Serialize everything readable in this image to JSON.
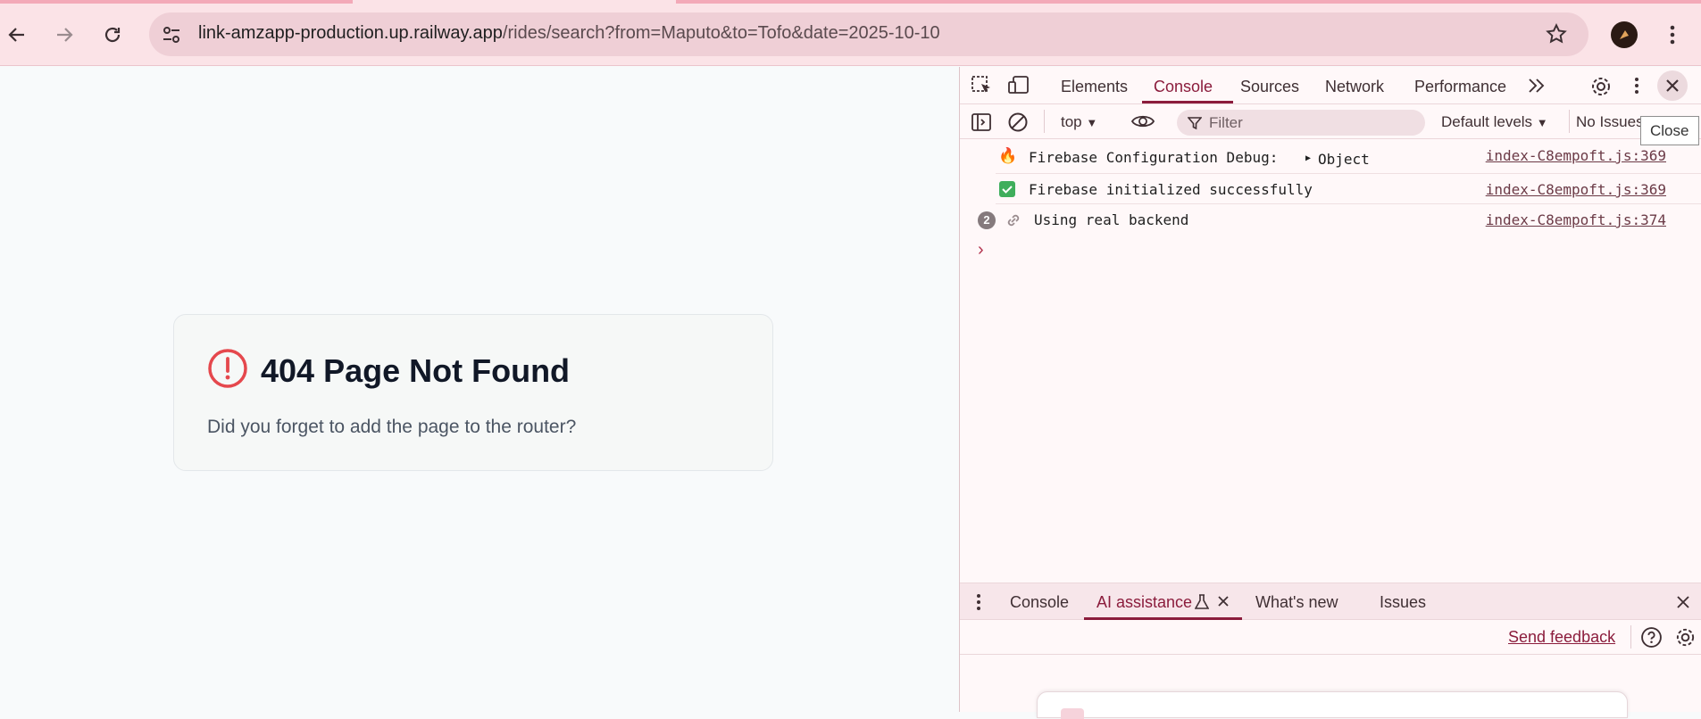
{
  "browser": {
    "url_host": "link-amzapp-production.up.railway.app",
    "url_path": "/rides/search?from=Maputo&to=Tofo&date=2025-10-10"
  },
  "page": {
    "title": "404 Page Not Found",
    "message": "Did you forget to add the page to the router?"
  },
  "devtools": {
    "tabs": [
      "Elements",
      "Console",
      "Sources",
      "Network",
      "Performance"
    ],
    "active_tab": "Console",
    "toolbar": {
      "context": "top",
      "filter_placeholder": "Filter",
      "levels": "Default levels",
      "issues": "No Issues"
    },
    "messages": [
      {
        "icon": "fire-icon",
        "text": "Firebase Configuration Debug:",
        "object": "Object",
        "source": "index-C8empoft.js:369"
      },
      {
        "icon": "check-icon",
        "text": "Firebase initialized successfully",
        "source": "index-C8empoft.js:369"
      },
      {
        "icon": "link-icon",
        "count": "2",
        "text": "Using real backend",
        "source": "index-C8empoft.js:374"
      }
    ],
    "drawer_tabs": [
      "Console",
      "AI assistance",
      "What's new",
      "Issues"
    ],
    "drawer_active": "AI assistance",
    "send_feedback": "Send feedback",
    "tooltip": "Close"
  },
  "colors": {
    "accent": "#8b1c3c",
    "error": "#e5484d",
    "topbar": "#fbe3e7"
  }
}
